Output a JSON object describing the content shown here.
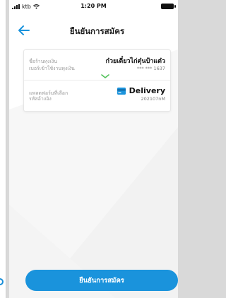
{
  "status_bar": {
    "carrier": "ktb",
    "time": "1:20 PM"
  },
  "header": {
    "title": "ยืนยันการสมัคร"
  },
  "shop": {
    "name_label": "ชื่อร้านทุงเงิน",
    "name_value": "ก๋วยเตี๋ยวไก่ตุ๋นป้าแต๋ว",
    "account_label": "เบอร์เข้าใช้งานทุงเงิน",
    "account_value": "*** *** 1637"
  },
  "platform": {
    "platform_label": "แพลตฟอร์มที่เลือก",
    "platform_value": "Delivery",
    "ref_label": "รหัสอ้างอิง",
    "ref_value": "202107nM"
  },
  "footer": {
    "confirm_label": "ยืนยันการสมัคร"
  },
  "colors": {
    "accent": "#1a93dc",
    "check": "#52c25a"
  }
}
